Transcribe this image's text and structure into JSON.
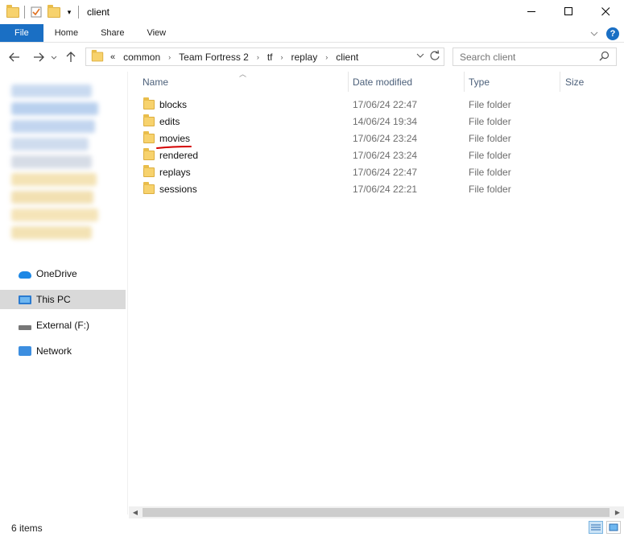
{
  "window": {
    "title": "client"
  },
  "ribbon": {
    "tabs": [
      "File",
      "Home",
      "Share",
      "View"
    ],
    "help": "?"
  },
  "address": {
    "prefix": "«",
    "crumbs": [
      "common",
      "Team Fortress 2",
      "tf",
      "replay",
      "client"
    ]
  },
  "search": {
    "placeholder": "Search client"
  },
  "sidebar": {
    "items": [
      {
        "label": "OneDrive",
        "icon": "cloud-icon"
      },
      {
        "label": "This PC",
        "icon": "computer-icon",
        "selected": true
      },
      {
        "label": "External (F:)",
        "icon": "drive-icon"
      },
      {
        "label": "Network",
        "icon": "network-icon"
      }
    ]
  },
  "columns": {
    "name": "Name",
    "date": "Date modified",
    "type": "Type",
    "size": "Size"
  },
  "files": [
    {
      "name": "blocks",
      "date": "17/06/24 22:47",
      "type": "File folder"
    },
    {
      "name": "edits",
      "date": "14/06/24 19:34",
      "type": "File folder"
    },
    {
      "name": "movies",
      "date": "17/06/24 23:24",
      "type": "File folder"
    },
    {
      "name": "rendered",
      "date": "17/06/24 23:24",
      "type": "File folder"
    },
    {
      "name": "replays",
      "date": "17/06/24 22:47",
      "type": "File folder"
    },
    {
      "name": "sessions",
      "date": "17/06/24 22:21",
      "type": "File folder"
    }
  ],
  "status": {
    "count": "6 items"
  },
  "colors": {
    "accent": "#1a6fc4",
    "selected_nav": "#d9d9d9",
    "annotation": "#d40000"
  }
}
